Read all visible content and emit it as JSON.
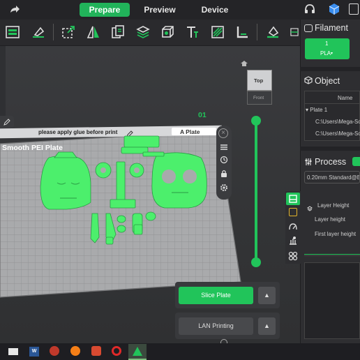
{
  "tabs": {
    "prepare": "Prepare",
    "preview": "Preview",
    "device": "Device"
  },
  "plate": {
    "note": "please apply glue before print",
    "name_tab": "A Plate",
    "surface": "Smooth PEI Plate",
    "number": "01"
  },
  "view_cube": {
    "top": "Top",
    "front": "Front"
  },
  "actions": {
    "slice": "Slice Plate",
    "lan": "LAN Printing"
  },
  "filament": {
    "title": "Filament",
    "slot": "1",
    "type": "PLA"
  },
  "object": {
    "title": "Object",
    "column": "Name",
    "plate_row": "Plate 1",
    "files": [
      "C:\\Users\\Mega-Soft\\",
      "C:\\Users\\Mega-Soft\\"
    ]
  },
  "process": {
    "title": "Process",
    "preset": "0.20mm Standard@B",
    "group": "Layer Height",
    "fields": [
      "Layer height",
      "First layer height"
    ]
  },
  "colors": {
    "accent": "#21c45a",
    "model": "#4cef6c"
  }
}
